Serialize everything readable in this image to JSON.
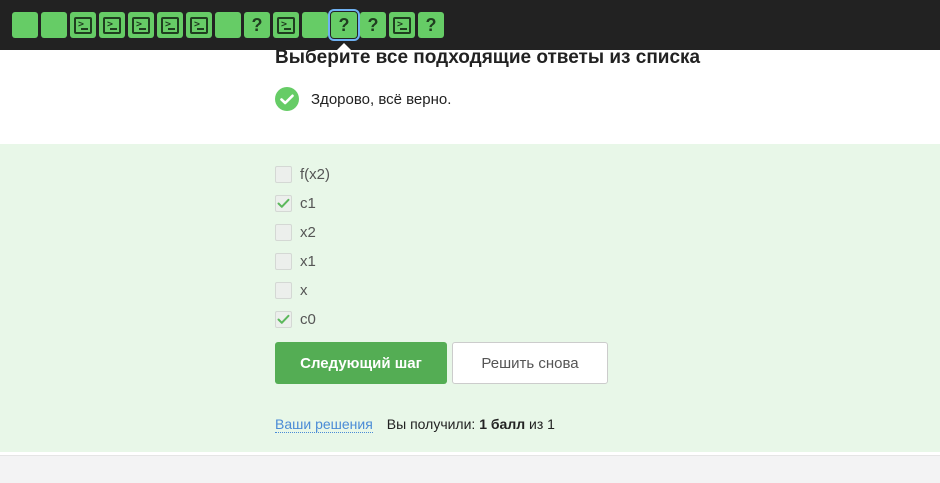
{
  "steps": [
    {
      "type": "plain",
      "active": false
    },
    {
      "type": "plain",
      "active": false
    },
    {
      "type": "code",
      "active": false
    },
    {
      "type": "code",
      "active": false
    },
    {
      "type": "code",
      "active": false
    },
    {
      "type": "code",
      "active": false
    },
    {
      "type": "code",
      "active": false
    },
    {
      "type": "plain",
      "active": false
    },
    {
      "type": "question",
      "active": false
    },
    {
      "type": "code",
      "active": false
    },
    {
      "type": "plain",
      "active": false
    },
    {
      "type": "question",
      "active": true
    },
    {
      "type": "question",
      "active": false
    },
    {
      "type": "code",
      "active": false
    },
    {
      "type": "question",
      "active": false
    }
  ],
  "colors": {
    "topbar": "#222222",
    "step_passed": "#66cc66",
    "active_outline": "#6fb1f2",
    "answer_bg": "#e8f7e8",
    "primary_button": "#54ad54",
    "link": "#4a8bd6"
  },
  "question": {
    "title": "Выберите все подходящие ответы из списка"
  },
  "result": {
    "icon": "check-circle-icon",
    "text": "Здорово, всё верно."
  },
  "options": [
    {
      "label": "f(x2)",
      "checked": false
    },
    {
      "label": "c1",
      "checked": true
    },
    {
      "label": "x2",
      "checked": false
    },
    {
      "label": "x1",
      "checked": false
    },
    {
      "label": "x",
      "checked": false
    },
    {
      "label": "c0",
      "checked": true
    }
  ],
  "buttons": {
    "next": "Следующий шаг",
    "retry": "Решить снова"
  },
  "footer": {
    "solutions_link": "Ваши решения",
    "score_prefix": "Вы получили:",
    "score_value": "1 балл",
    "score_suffix": "из 1"
  }
}
